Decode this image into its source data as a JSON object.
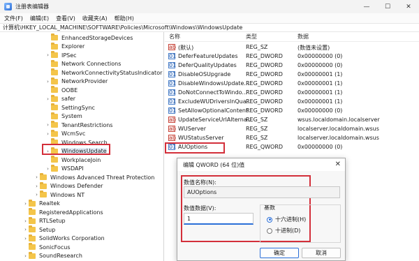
{
  "window": {
    "title": "注册表编辑器",
    "controls": [
      "—",
      "☐",
      "✕"
    ]
  },
  "menu": [
    "文件(F)",
    "编辑(E)",
    "查看(V)",
    "收藏夹(A)",
    "帮助(H)"
  ],
  "address": "计算机\\HKEY_LOCAL_MACHINE\\SOFTWARE\\Policies\\Microsoft\\Windows\\WindowsUpdate",
  "tree": [
    {
      "label": "EnhancedStorageDevices",
      "expander": "",
      "selected": false
    },
    {
      "label": "Explorer",
      "expander": "",
      "selected": false
    },
    {
      "label": "IPSec",
      "expander": "›",
      "selected": false
    },
    {
      "label": "Network Connections",
      "expander": "",
      "selected": false
    },
    {
      "label": "NetworkConnectivityStatusIndicator",
      "expander": "",
      "selected": false
    },
    {
      "label": "NetworkProvider",
      "expander": "›",
      "selected": false
    },
    {
      "label": "OOBE",
      "expander": "",
      "selected": false
    },
    {
      "label": "safer",
      "expander": "›",
      "selected": false
    },
    {
      "label": "SettingSync",
      "expander": "",
      "selected": false
    },
    {
      "label": "System",
      "expander": "",
      "selected": false
    },
    {
      "label": "TenantRestrictions",
      "expander": "›",
      "selected": false
    },
    {
      "label": "WcmSvc",
      "expander": "›",
      "selected": false
    },
    {
      "label": "Windows Search",
      "expander": "",
      "selected": false
    },
    {
      "label": "WindowsUpdate",
      "expander": "›",
      "selected": true
    },
    {
      "label": "WorkplaceJoin",
      "expander": "",
      "selected": false
    },
    {
      "label": "WSDAPI",
      "expander": "›",
      "selected": false
    },
    {
      "label": "Windows Advanced Threat Protection",
      "expander": "›",
      "selected": false
    },
    {
      "label": "Windows Defender",
      "expander": "›",
      "selected": false
    },
    {
      "label": "Windows NT",
      "expander": "›",
      "selected": false
    },
    {
      "label": "Realtek",
      "expander": "›",
      "selected": false
    },
    {
      "label": "RegisteredApplications",
      "expander": "",
      "selected": false
    },
    {
      "label": "RTLSetup",
      "expander": "›",
      "selected": false
    },
    {
      "label": "Setup",
      "expander": "›",
      "selected": false
    },
    {
      "label": "SolidWorks Corporation",
      "expander": "›",
      "selected": false
    },
    {
      "label": "SonicFocus",
      "expander": "",
      "selected": false
    },
    {
      "label": "SoundResearch",
      "expander": "›",
      "selected": false
    }
  ],
  "list": {
    "headers": {
      "name": "名称",
      "type": "类型",
      "data": "数据"
    },
    "rows": [
      {
        "name": "(默认)",
        "type": "REG_SZ",
        "data": "(数值未设置)",
        "kind": "sz"
      },
      {
        "name": "DeferFeatureUpdates",
        "type": "REG_DWORD",
        "data": "0x00000000 (0)",
        "kind": "dw"
      },
      {
        "name": "DeferQualityUpdates",
        "type": "REG_DWORD",
        "data": "0x00000000 (0)",
        "kind": "dw"
      },
      {
        "name": "DisableOSUpgrade",
        "type": "REG_DWORD",
        "data": "0x00000001 (1)",
        "kind": "dw"
      },
      {
        "name": "DisableWindowsUpdate...",
        "type": "REG_DWORD",
        "data": "0x00000001 (1)",
        "kind": "dw"
      },
      {
        "name": "DoNotConnectToWindo...",
        "type": "REG_DWORD",
        "data": "0x00000001 (1)",
        "kind": "dw"
      },
      {
        "name": "ExcludeWUDriversInQua...",
        "type": "REG_DWORD",
        "data": "0x00000001 (1)",
        "kind": "dw"
      },
      {
        "name": "SetAllowOptionalContent",
        "type": "REG_DWORD",
        "data": "0x00000000 (0)",
        "kind": "dw"
      },
      {
        "name": "UpdateServiceUrlAlterna...",
        "type": "REG_SZ",
        "data": "wsus.localdomain.localserver",
        "kind": "sz"
      },
      {
        "name": "WUServer",
        "type": "REG_SZ",
        "data": "localserver.localdomain.wsus",
        "kind": "sz"
      },
      {
        "name": "WUStatusServer",
        "type": "REG_SZ",
        "data": "localserver.localdomain.wsus",
        "kind": "sz"
      },
      {
        "name": "AUOptions",
        "type": "REG_QWORD",
        "data": "0x00000000 (0)",
        "kind": "dw"
      }
    ]
  },
  "dialog": {
    "title": "编辑 QWORD (64 位)值",
    "close": "✕",
    "name_label": "数值名称(N):",
    "name_value": "AUOptions",
    "data_label": "数值数据(V):",
    "data_value": "1",
    "base_label": "基数",
    "radio_hex": "十六进制(H)",
    "radio_dec": "十进制(D)",
    "hex_selected": true,
    "ok": "确定",
    "cancel": "取消"
  },
  "colors": {
    "highlight": "#d32f3a",
    "accent": "#2b6fd8"
  }
}
